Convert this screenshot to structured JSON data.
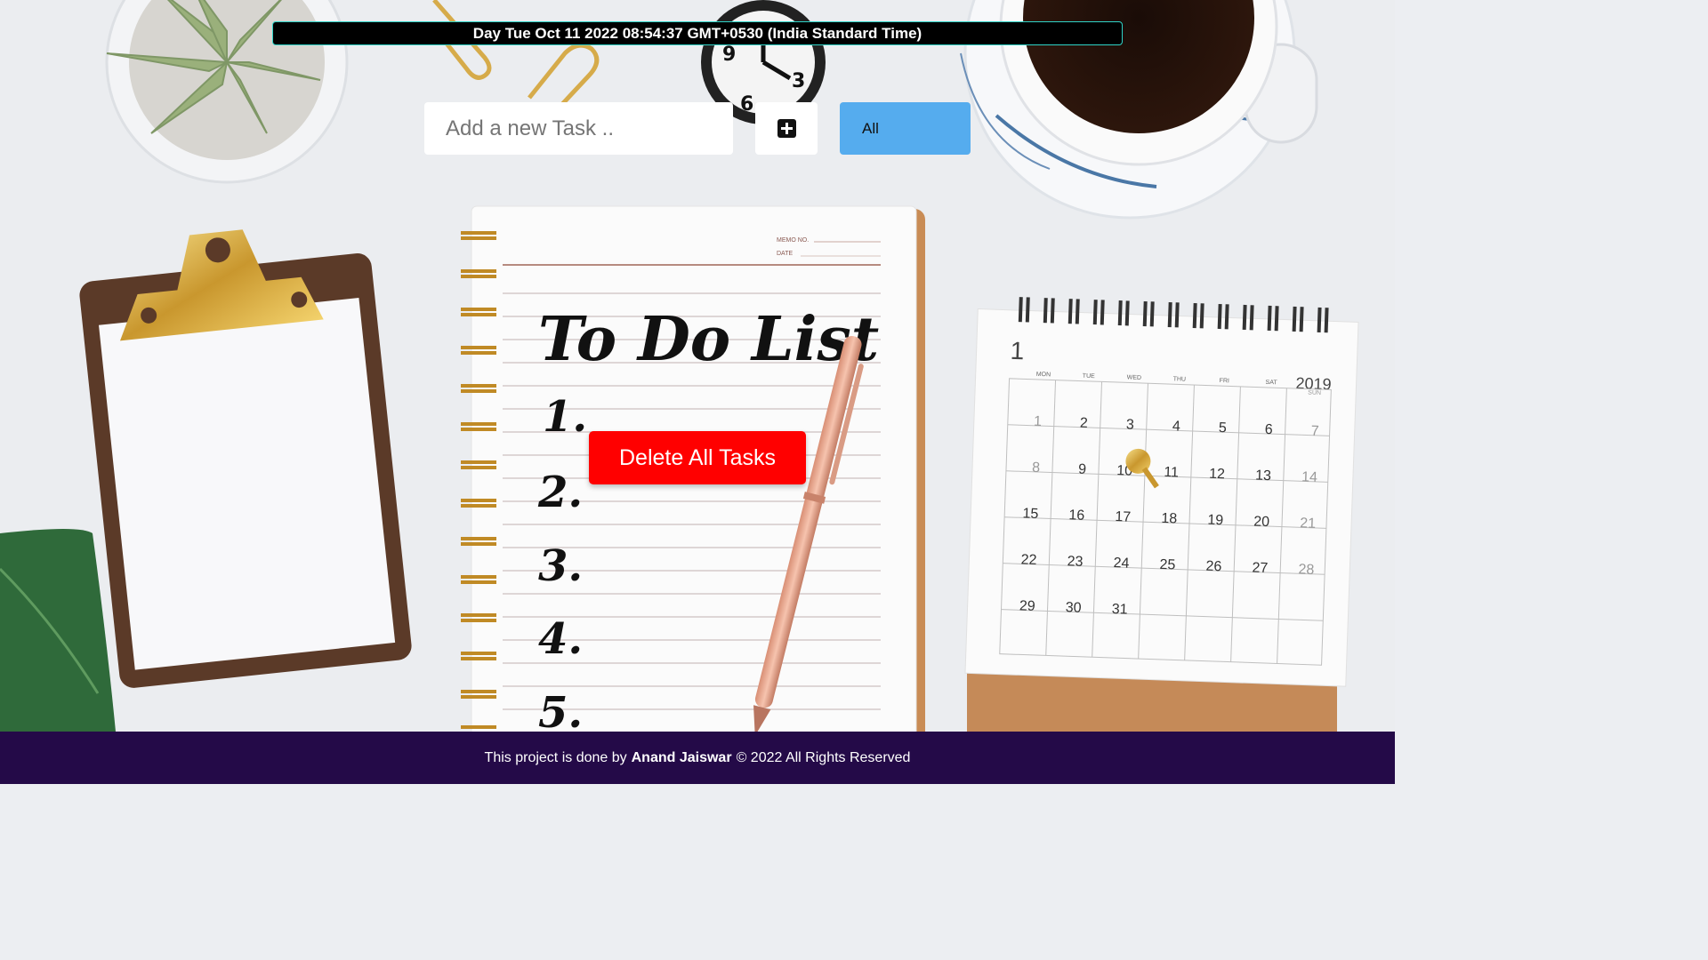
{
  "clock": {
    "text": "Day Tue Oct 11 2022 08:54:37 GMT+0530 (India Standard Time)"
  },
  "controls": {
    "input_placeholder": "Add a new Task ..",
    "add_icon": "plus-square-icon",
    "filter_selected": "All",
    "delete_all_label": "Delete All Tasks"
  },
  "notebook": {
    "memo_label": "MEMO NO.",
    "date_label": "DATE",
    "title": "To Do List",
    "numbers": [
      "1.",
      "2.",
      "3.",
      "4.",
      "5."
    ]
  },
  "calendar": {
    "month_number": "1",
    "year": "2019",
    "weekdays": [
      "MON",
      "TUE",
      "WED",
      "THU",
      "FRI",
      "SAT",
      "SUN"
    ],
    "days": [
      "1",
      "2",
      "3",
      "4",
      "5",
      "6",
      "7",
      "8",
      "9",
      "10",
      "11",
      "12",
      "13",
      "14",
      "15",
      "16",
      "17",
      "18",
      "19",
      "20",
      "21",
      "22",
      "23",
      "24",
      "25",
      "26",
      "27",
      "28",
      "29",
      "30",
      "31"
    ]
  },
  "footer": {
    "prefix": "This project is done by",
    "author": "Anand Jaiswar",
    "suffix": "© 2022 All Rights Reserved"
  },
  "colors": {
    "clock_bg": "#000000",
    "clock_border": "#2fd3c7",
    "filter_bg": "#55acee",
    "delete_bg": "#ff0000",
    "footer_bg": "#240a48"
  }
}
